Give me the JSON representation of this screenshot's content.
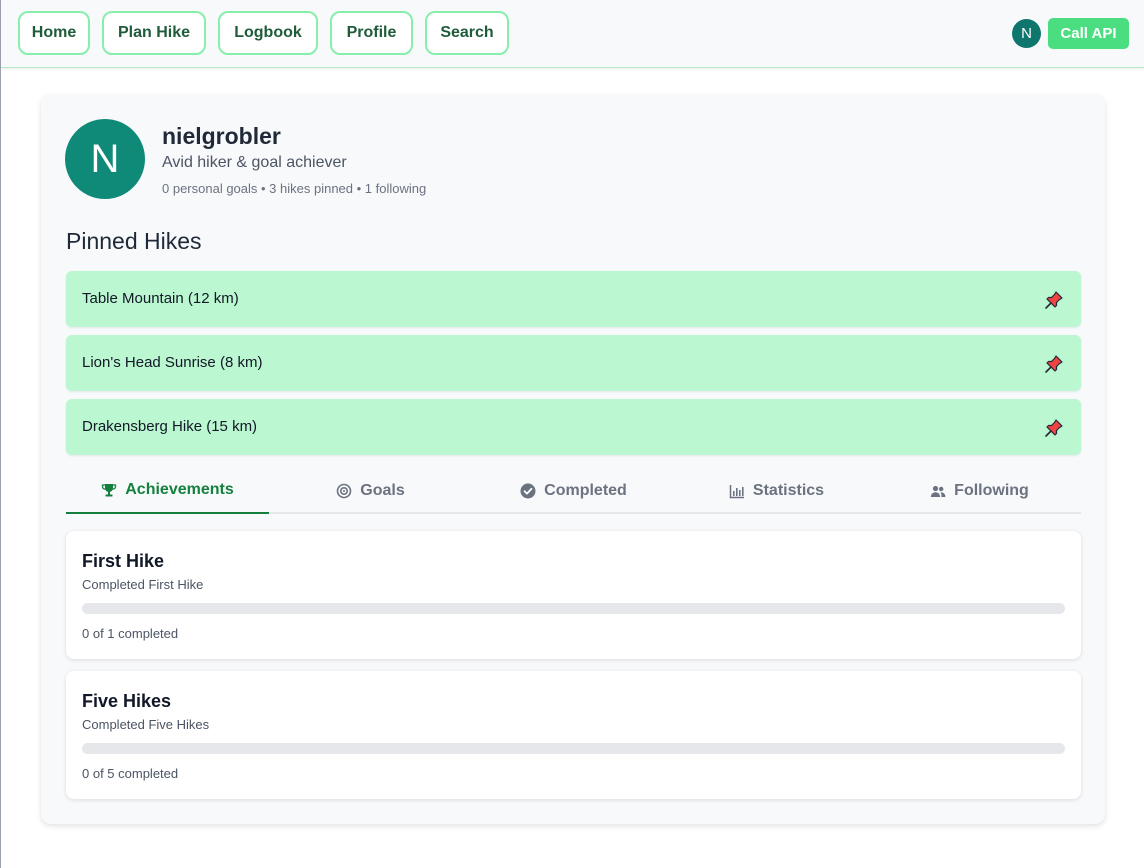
{
  "nav": {
    "items": [
      "Home",
      "Plan Hike",
      "Logbook",
      "Profile",
      "Search"
    ],
    "user_initial": "N",
    "api_button": "Call API"
  },
  "profile": {
    "avatar_initial": "N",
    "username": "nielgrobler",
    "bio": "Avid hiker & goal achiever",
    "stats": "0 personal goals • 3 hikes pinned • 1 following"
  },
  "pinned": {
    "title": "Pinned Hikes",
    "hikes": [
      {
        "label": "Table Mountain (12 km)",
        "icon": "pushpin-icon"
      },
      {
        "label": "Lion's Head Sunrise (8 km)",
        "icon": "pushpin-icon"
      },
      {
        "label": "Drakensberg Hike (15 km)",
        "icon": "pushpin-icon"
      }
    ]
  },
  "tabs": [
    {
      "label": "Achievements",
      "icon": "trophy-icon",
      "active": true
    },
    {
      "label": "Goals",
      "icon": "target-icon",
      "active": false
    },
    {
      "label": "Completed",
      "icon": "check-circle-icon",
      "active": false
    },
    {
      "label": "Statistics",
      "icon": "bar-chart-icon",
      "active": false
    },
    {
      "label": "Following",
      "icon": "users-icon",
      "active": false
    }
  ],
  "achievements": [
    {
      "title": "First Hike",
      "description": "Completed First Hike",
      "progress_text": "0 of 1 completed",
      "progress": 0
    },
    {
      "title": "Five Hikes",
      "description": "Completed Five Hikes",
      "progress_text": "0 of 5 completed",
      "progress": 0
    }
  ],
  "colors": {
    "accent": "#15803d",
    "pinned_bg": "#bbf7d0",
    "avatar": "#0f8a78",
    "api_button": "#4ade80"
  }
}
